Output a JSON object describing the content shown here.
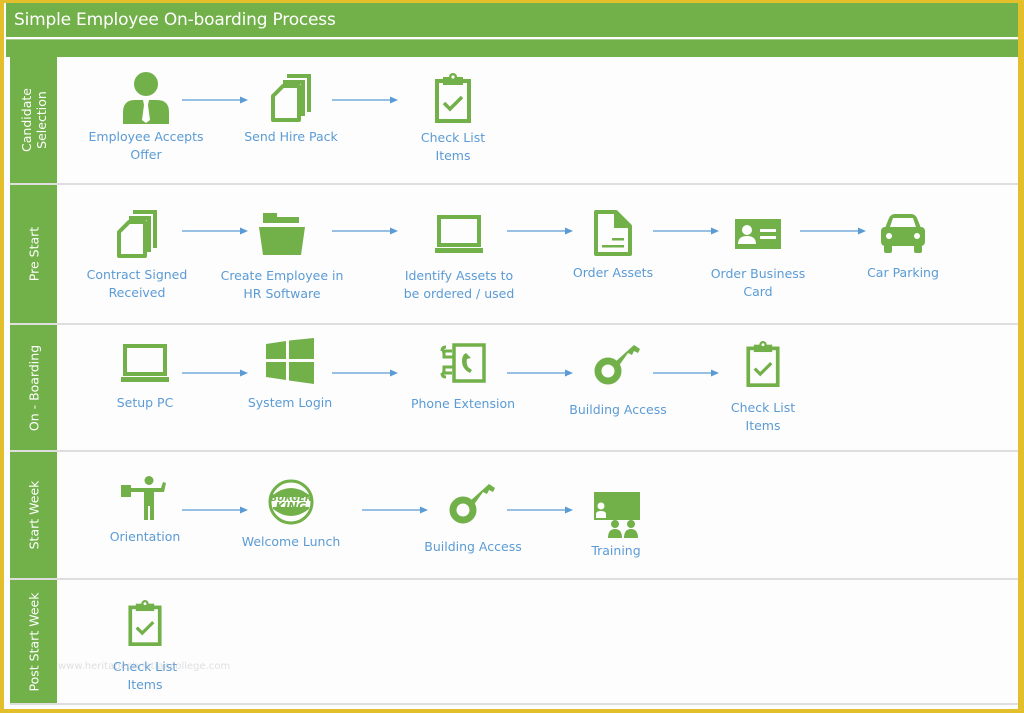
{
  "title": "Simple Employee On-boarding Process",
  "colors": {
    "accent": "#72b04a",
    "label_text": "#5b9bd5",
    "arrow": "#5b9bd5",
    "frame": "#e3c02b"
  },
  "lanes": [
    {
      "label": "Candidate\nSelection",
      "steps": [
        {
          "label": "Employee Accepts\nOffer",
          "icon": "employee-icon"
        },
        {
          "label": "Send Hire Pack",
          "icon": "documents-icon"
        },
        {
          "label": "Check List\nItems",
          "icon": "checklist-icon"
        }
      ]
    },
    {
      "label": "Pre Start",
      "steps": [
        {
          "label": "Contract Signed\nReceived",
          "icon": "documents-icon"
        },
        {
          "label": "Create Employee in\nHR Software",
          "icon": "folder-icon"
        },
        {
          "label": "Identify Assets to\nbe ordered / used",
          "icon": "monitor-icon"
        },
        {
          "label": "Order Assets",
          "icon": "document-icon"
        },
        {
          "label": "Order Business\nCard",
          "icon": "id-card-icon"
        },
        {
          "label": "Car Parking",
          "icon": "car-icon"
        }
      ]
    },
    {
      "label": "On - Boarding",
      "steps": [
        {
          "label": "Setup PC",
          "icon": "monitor-icon"
        },
        {
          "label": "System Login",
          "icon": "windows-icon"
        },
        {
          "label": "Phone Extension",
          "icon": "phonebook-icon"
        },
        {
          "label": "Building Access",
          "icon": "key-icon"
        },
        {
          "label": "Check List\nItems",
          "icon": "checklist-icon"
        }
      ]
    },
    {
      "label": "Start Week",
      "steps": [
        {
          "label": "Orientation",
          "icon": "guide-icon"
        },
        {
          "label": "Welcome Lunch",
          "icon": "burger-king-logo-icon"
        },
        {
          "label": "Building Access",
          "icon": "key-icon"
        },
        {
          "label": "Training",
          "icon": "training-icon"
        }
      ]
    },
    {
      "label": "Post Start Week",
      "steps": [
        {
          "label": "Check List\nItems",
          "icon": "checklist-icon"
        }
      ]
    }
  ],
  "watermark": "www.heritagechristiancollege.com",
  "logo_text": {
    "line1": "BURGER",
    "line2": "KING"
  }
}
